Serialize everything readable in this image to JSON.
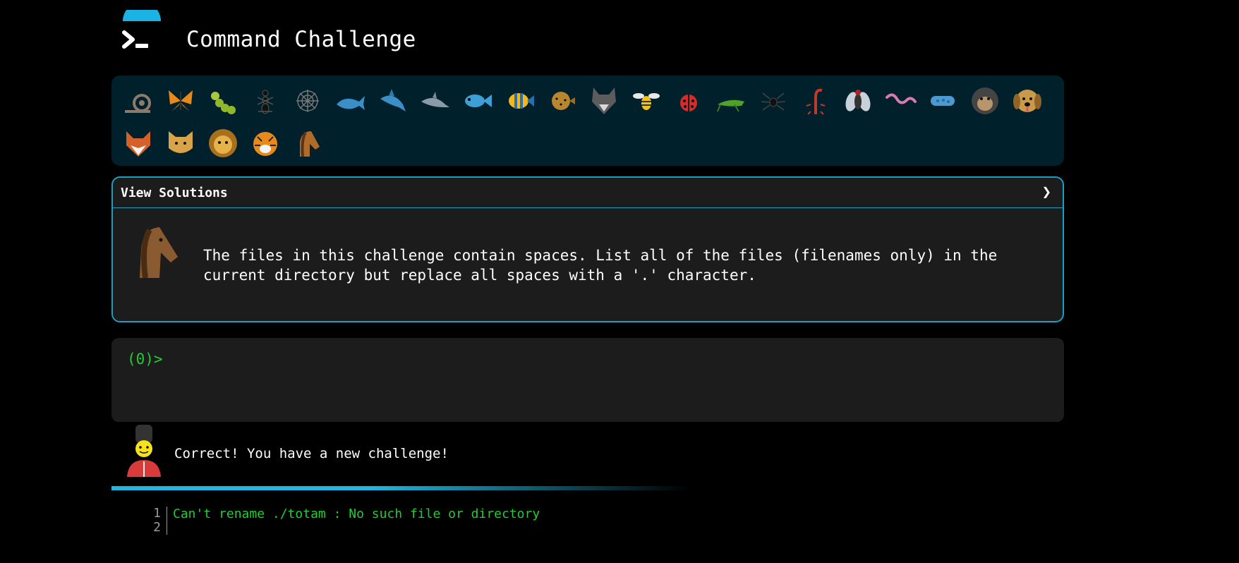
{
  "header": {
    "title": "Command Challenge",
    "logo_icon": "terminal-prompt-icon"
  },
  "badges": {
    "row1": [
      {
        "name": "snail-badge-icon"
      },
      {
        "name": "butterfly-badge-icon"
      },
      {
        "name": "caterpillar-badge-icon"
      },
      {
        "name": "ant-badge-icon"
      },
      {
        "name": "spiderweb-badge-icon"
      },
      {
        "name": "whale-badge-icon"
      },
      {
        "name": "shark-badge-icon"
      },
      {
        "name": "dolphin-badge-icon"
      },
      {
        "name": "fish-badge-icon"
      },
      {
        "name": "tropical-fish-badge-icon"
      },
      {
        "name": "blowfish-badge-icon"
      },
      {
        "name": "wolf-badge-icon"
      },
      {
        "name": "bee-badge-icon"
      },
      {
        "name": "ladybug-badge-icon"
      },
      {
        "name": "cricket-badge-icon"
      },
      {
        "name": "spider-badge-icon"
      },
      {
        "name": "scorpion-badge-icon"
      },
      {
        "name": "fly-badge-icon"
      },
      {
        "name": "worm-badge-icon"
      },
      {
        "name": "microbe-badge-icon"
      },
      {
        "name": "gorilla-badge-icon"
      },
      {
        "name": "dog-badge-icon"
      }
    ],
    "row2": [
      {
        "name": "fox-badge-icon"
      },
      {
        "name": "cat-badge-icon"
      },
      {
        "name": "lion-badge-icon"
      },
      {
        "name": "tiger-badge-icon"
      },
      {
        "name": "horse-badge-icon"
      }
    ]
  },
  "challenge": {
    "header_label": "View Solutions",
    "toggle_glyph": "❯",
    "avatar_icon": "horse-head-icon",
    "text": "The files in this challenge contain spaces. List all of the files (filenames only) in the\ncurrent directory but replace all spaces with a '.' character."
  },
  "terminal": {
    "prompt": "(0)>",
    "input_value": ""
  },
  "status": {
    "icon": "royal-guard-icon",
    "message": "Correct! You have a new challenge!"
  },
  "output": {
    "lines": [
      {
        "number": "1",
        "text": "Can't rename ./totam : No such file or directory"
      },
      {
        "number": "2",
        "text": ""
      }
    ]
  },
  "colors": {
    "accent": "#1a9ec2",
    "terminal_green": "#22cc33",
    "panel_bg": "#00202b",
    "card_bg": "#1c1c1c",
    "progress": "#1fb6e0"
  }
}
